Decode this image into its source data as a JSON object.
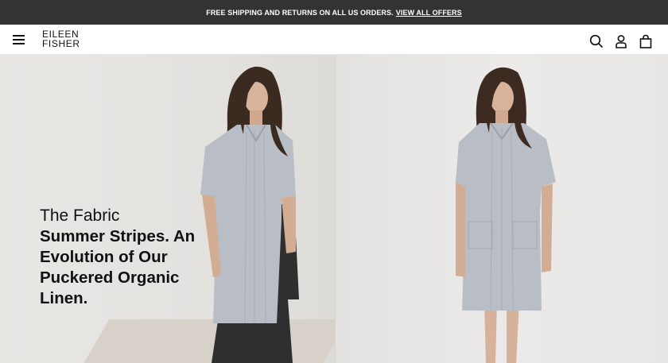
{
  "promo": {
    "text": "FREE SHIPPING AND RETURNS ON ALL US ORDERS.",
    "link": "VIEW ALL OFFERS"
  },
  "header": {
    "logo_line1": "EILEEN",
    "logo_line2": "FISHER",
    "icons": [
      "menu-icon",
      "search-icon",
      "account-icon",
      "shopping-bag-icon"
    ]
  },
  "hero": {
    "eyebrow": "The Fabric",
    "headline": "Summer Stripes. An Evolution of Our Puckered Organic Linen."
  },
  "colors": {
    "promo_bg": "#333333",
    "text": "#111111",
    "dress": "#b9bec6",
    "pants": "#2f2f2f"
  }
}
